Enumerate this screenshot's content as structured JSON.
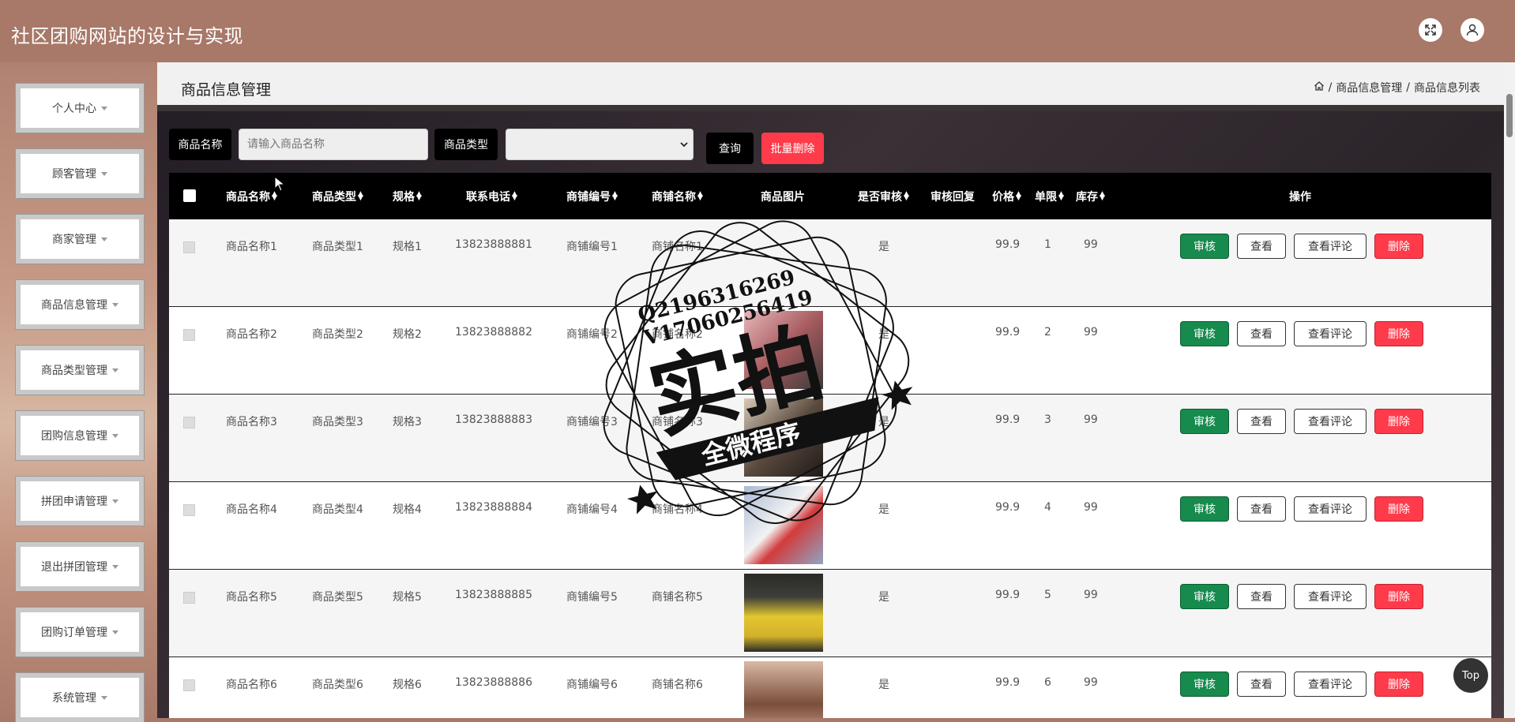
{
  "app": {
    "title": "社区团购网站的设计与实现"
  },
  "topbar": {
    "fullscreen_icon": "expand-icon",
    "user_icon": "user-icon"
  },
  "sidebar": {
    "items": [
      {
        "label": "个人中心"
      },
      {
        "label": "顾客管理"
      },
      {
        "label": "商家管理"
      },
      {
        "label": "商品信息管理"
      },
      {
        "label": "商品类型管理"
      },
      {
        "label": "团购信息管理"
      },
      {
        "label": "拼团申请管理"
      },
      {
        "label": "退出拼团管理"
      },
      {
        "label": "团购订单管理"
      },
      {
        "label": "系统管理"
      }
    ]
  },
  "page": {
    "title": "商品信息管理",
    "breadcrumb": {
      "home_icon": "home-icon",
      "level1": "商品信息管理",
      "level2": "商品信息列表",
      "separator": "/"
    }
  },
  "search": {
    "name_label": "商品名称",
    "name_placeholder": "请输入商品名称",
    "type_label": "商品类型",
    "type_selected": "",
    "query_button": "查询",
    "batch_delete_button": "批量删除"
  },
  "table": {
    "headers": {
      "name": "商品名称",
      "type": "商品类型",
      "spec": "规格",
      "phone": "联系电话",
      "shop_no": "商铺编号",
      "shop_name": "商铺名称",
      "image": "商品图片",
      "audited": "是否审核",
      "reply": "审核回复",
      "price": "价格",
      "limit": "单限",
      "stock": "库存",
      "actions": "操作"
    },
    "action_labels": {
      "audit": "审核",
      "view": "查看",
      "comment": "查看评论",
      "delete": "删除"
    },
    "rows": [
      {
        "name": "商品名称1",
        "type": "商品类型1",
        "spec": "规格1",
        "phone": "13823888881",
        "shop_no": "商铺编号1",
        "shop_name": "商铺名称1",
        "audited": "是",
        "reply": "",
        "price": "99.9",
        "limit": "1",
        "stock": "99",
        "image_color": "#a9876f"
      },
      {
        "name": "商品名称2",
        "type": "商品类型2",
        "spec": "规格2",
        "phone": "13823888882",
        "shop_no": "商铺编号2",
        "shop_name": "商铺名称2",
        "audited": "是",
        "reply": "",
        "price": "99.9",
        "limit": "2",
        "stock": "99",
        "image_color": "#c98a8c"
      },
      {
        "name": "商品名称3",
        "type": "商品类型3",
        "spec": "规格3",
        "phone": "13823888883",
        "shop_no": "商铺编号3",
        "shop_name": "商铺名称3",
        "audited": "是",
        "reply": "",
        "price": "99.9",
        "limit": "3",
        "stock": "99",
        "image_color": "#6a5a4e"
      },
      {
        "name": "商品名称4",
        "type": "商品类型4",
        "spec": "规格4",
        "phone": "13823888884",
        "shop_no": "商铺编号4",
        "shop_name": "商铺名称4",
        "audited": "是",
        "reply": "",
        "price": "99.9",
        "limit": "4",
        "stock": "99",
        "image_color": "#8fa4c4"
      },
      {
        "name": "商品名称5",
        "type": "商品类型5",
        "spec": "规格5",
        "phone": "13823888885",
        "shop_no": "商铺编号5",
        "shop_name": "商铺名称5",
        "audited": "是",
        "reply": "",
        "price": "99.9",
        "limit": "5",
        "stock": "99",
        "image_color": "#3e3f3a"
      },
      {
        "name": "商品名称6",
        "type": "商品类型6",
        "spec": "规格6",
        "phone": "13823888886",
        "shop_no": "商铺编号6",
        "shop_name": "商铺名称6",
        "audited": "是",
        "reply": "",
        "price": "99.9",
        "limit": "6",
        "stock": "99",
        "image_color": "#c9a796"
      }
    ]
  },
  "watermark": {
    "line1": "Q2196316269",
    "line2": "V17060256419",
    "big": "实拍",
    "ribbon": "全微程序"
  },
  "scroll_top_button": "Top",
  "colors": {
    "topbar": "#a87868",
    "audit": "#178a4e",
    "delete": "#ff3b4b",
    "header": "#000000"
  }
}
